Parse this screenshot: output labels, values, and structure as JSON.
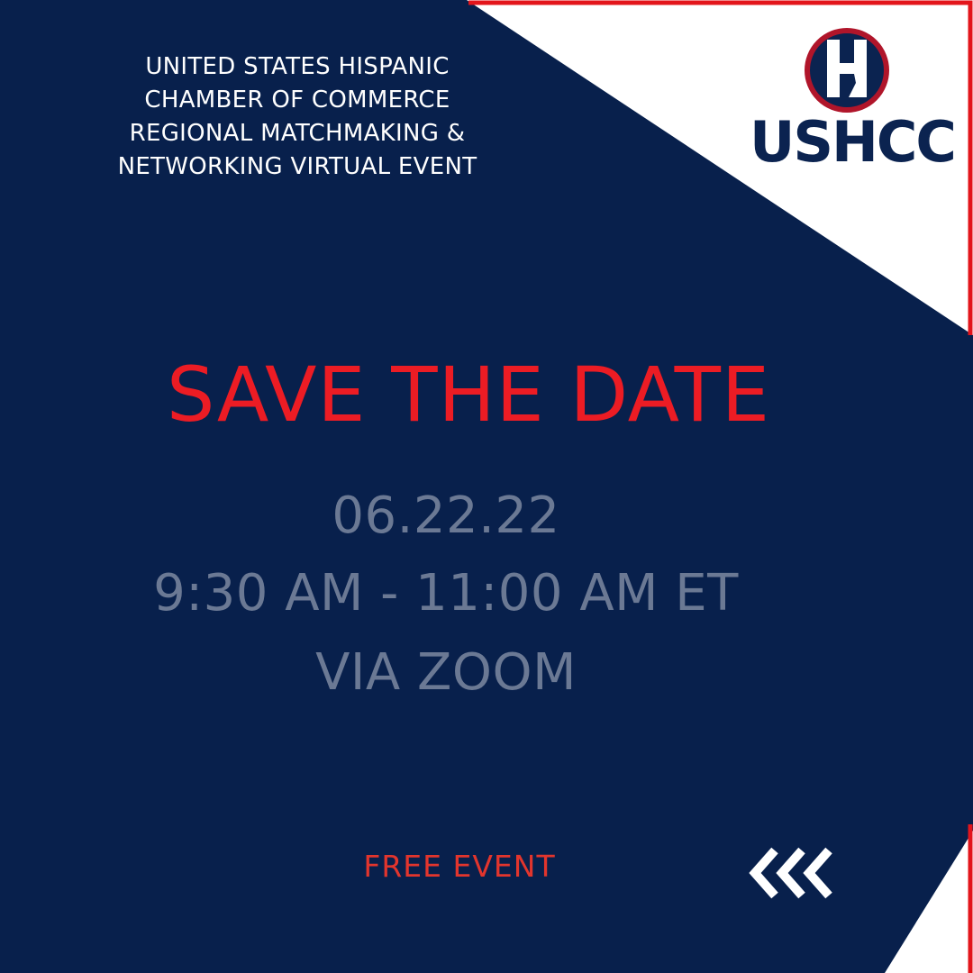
{
  "heading": {
    "lines": [
      "UNITED STATES HISPANIC",
      "CHAMBER OF COMMERCE",
      "REGIONAL MATCHMAKING &",
      "NETWORKING VIRTUAL EVENT"
    ]
  },
  "logo": {
    "text": "USHCC"
  },
  "headline": "SAVE THE DATE",
  "details": {
    "date": "06.22.22",
    "time": "9:30 AM - 11:00 AM ET",
    "platform": "VIA ZOOM"
  },
  "free_label": "FREE EVENT",
  "icons": {
    "back_arrows": "triple-chevron-left-icon"
  },
  "colors": {
    "background": "#08204c",
    "accent_red": "#ec1c24",
    "detail_gray": "#6b7994",
    "white": "#ffffff"
  }
}
